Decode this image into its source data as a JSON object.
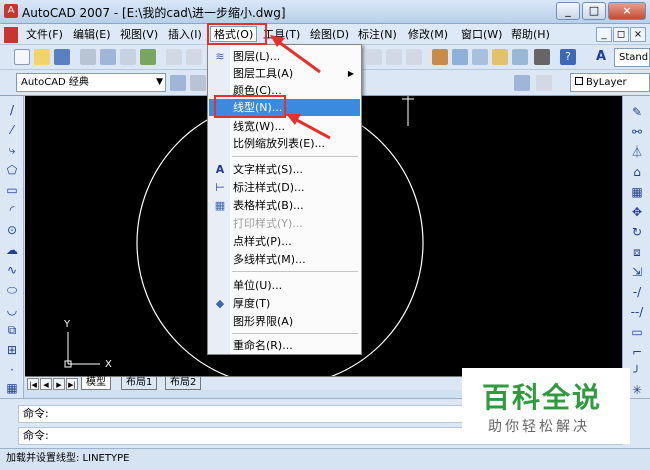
{
  "window": {
    "title": "AutoCAD 2007 - [E:\\我的cad\\进一步缩小.dwg]",
    "min_label": "_",
    "max_label": "□",
    "close_label": "×"
  },
  "menubar": {
    "items": [
      "文件(F)",
      "编辑(E)",
      "视图(V)",
      "插入(I)",
      "格式(O)",
      "工具(T)",
      "绘图(D)",
      "标注(N)",
      "修改(M)",
      "窗口(W)",
      "帮助(H)"
    ],
    "active_index": 4
  },
  "toolbar": {
    "workspace_combo": "AutoCAD 经典",
    "text_style_prefix": "Stand",
    "layer_combo": "ByLayer"
  },
  "format_menu": {
    "items": [
      {
        "label": "图层(L)...",
        "icon": "layers-icon",
        "submenu": false,
        "disabled": false
      },
      {
        "label": "图层工具(A)",
        "icon": "",
        "submenu": true,
        "disabled": false
      },
      {
        "label": "颜色(C)...",
        "icon": "",
        "submenu": false,
        "disabled": false
      },
      {
        "label": "线型(N)...",
        "icon": "",
        "submenu": false,
        "disabled": false,
        "highlighted": true
      },
      {
        "label": "线宽(W)...",
        "icon": "",
        "submenu": false,
        "disabled": false
      },
      {
        "label": "比例缩放列表(E)...",
        "icon": "",
        "submenu": false,
        "disabled": false
      },
      {
        "label": "文字样式(S)...",
        "icon": "text-style-icon",
        "submenu": false,
        "disabled": false
      },
      {
        "label": "标注样式(D)...",
        "icon": "dimension-style-icon",
        "submenu": false,
        "disabled": false
      },
      {
        "label": "表格样式(B)...",
        "icon": "table-style-icon",
        "submenu": false,
        "disabled": false
      },
      {
        "label": "打印样式(Y)...",
        "icon": "",
        "submenu": false,
        "disabled": true
      },
      {
        "label": "点样式(P)...",
        "icon": "",
        "submenu": false,
        "disabled": false
      },
      {
        "label": "多线样式(M)...",
        "icon": "",
        "submenu": false,
        "disabled": false
      },
      {
        "label": "单位(U)...",
        "icon": "",
        "submenu": false,
        "disabled": false
      },
      {
        "label": "厚度(T)",
        "icon": "thickness-icon",
        "submenu": false,
        "disabled": false
      },
      {
        "label": "图形界限(A)",
        "icon": "",
        "submenu": false,
        "disabled": false
      },
      {
        "label": "重命名(R)...",
        "icon": "",
        "submenu": false,
        "disabled": false
      }
    ]
  },
  "canvas": {
    "background": "#000000",
    "ucs_x_label": "X",
    "ucs_y_label": "Y"
  },
  "layout_tabs": [
    "模型",
    "布局1",
    "布局2"
  ],
  "command": {
    "line1": "命令:",
    "line2": "命令:"
  },
  "status": {
    "text": "加载并设置线型:  LINETYPE"
  },
  "watermark": {
    "title": "百科全说",
    "subtitle": "助你轻松解决"
  },
  "colors": {
    "highlight": "#3a8ae0",
    "annotation_red": "#e8302a",
    "watermark_green": "#2f9a3e"
  }
}
